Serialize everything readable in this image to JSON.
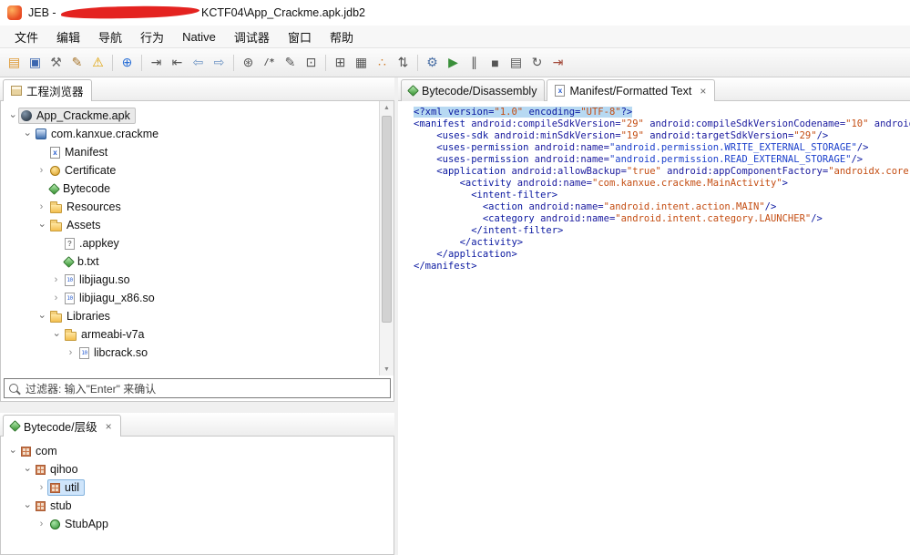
{
  "colors": {
    "tag": "#0a18a0",
    "attr": "#1a1a9e",
    "string": "#c44d12",
    "link": "#1c40cc",
    "selection": "#b7d9f2",
    "redaction": "#e42320"
  },
  "titlebar": {
    "prefix": "JEB - ",
    "suffix": "KCTF04\\App_Crackme.apk.jdb2"
  },
  "menubar": {
    "items": [
      "文件",
      "编辑",
      "导航",
      "行为",
      "Native",
      "调试器",
      "窗口",
      "帮助"
    ]
  },
  "toolbar": {
    "items": [
      {
        "name": "open-button",
        "glyph": "▤",
        "color": "#dd952d"
      },
      {
        "name": "save-button",
        "glyph": "▣",
        "color": "#3a66b0"
      },
      {
        "name": "tools-button",
        "glyph": "⚒",
        "color": "#6b6b6b"
      },
      {
        "name": "edit-button",
        "glyph": "✎",
        "color": "#a8772e"
      },
      {
        "name": "warning-button",
        "glyph": "⚠",
        "color": "#dfa000"
      },
      {
        "sep": true
      },
      {
        "name": "browser-button",
        "glyph": "⊕",
        "color": "#2a6fd6"
      },
      {
        "sep": true
      },
      {
        "name": "jump-in-button",
        "glyph": "⇥",
        "color": "#555555"
      },
      {
        "name": "jump-out-button",
        "glyph": "⇤",
        "color": "#555555"
      },
      {
        "name": "back-button",
        "glyph": "⇦",
        "color": "#6f95c4"
      },
      {
        "name": "forward-button",
        "glyph": "⇨",
        "color": "#6f95c4"
      },
      {
        "sep": true
      },
      {
        "name": "decompile-button",
        "glyph": "⊛",
        "color": "#555555"
      },
      {
        "name": "comment-button",
        "glyph": "/*",
        "color": "#555555",
        "small": true
      },
      {
        "name": "rename-button",
        "glyph": "✎",
        "color": "#555555"
      },
      {
        "name": "copy-button",
        "glyph": "⊡",
        "color": "#555555"
      },
      {
        "sep": true
      },
      {
        "name": "table-view-button",
        "glyph": "⊞",
        "color": "#555555"
      },
      {
        "name": "grid-view-button",
        "glyph": "▦",
        "color": "#555555"
      },
      {
        "name": "cross-refs-button",
        "glyph": "∴",
        "color": "#cf7c2a"
      },
      {
        "name": "sort-button",
        "glyph": "⇅",
        "color": "#555555"
      },
      {
        "sep": true
      },
      {
        "name": "debug-attach-button",
        "glyph": "⚙",
        "color": "#4a6fa5"
      },
      {
        "name": "debug-run-button",
        "glyph": "▶",
        "color": "#3a8f3a"
      },
      {
        "name": "debug-pause-button",
        "glyph": "∥",
        "color": "#555555"
      },
      {
        "name": "debug-stop-button",
        "glyph": "■",
        "color": "#555555"
      },
      {
        "name": "memory-button",
        "glyph": "▤",
        "color": "#555555"
      },
      {
        "name": "restart-button",
        "glyph": "↻",
        "color": "#555555"
      },
      {
        "name": "detach-button",
        "glyph": "⇥",
        "color": "#a34a3a"
      }
    ]
  },
  "project": {
    "tab_label": "工程浏览器",
    "filter_text": "过滤器: 输入\"Enter\" 来确认",
    "tree": [
      {
        "label": "App_Crackme.apk",
        "depth": 0,
        "icon": "apk",
        "chevron": "open",
        "selected": "inactive"
      },
      {
        "label": "com.kanxue.crackme",
        "depth": 1,
        "icon": "package",
        "chevron": "open"
      },
      {
        "label": "Manifest",
        "depth": 2,
        "icon": "manifest",
        "chevron": null
      },
      {
        "label": "Certificate",
        "depth": 2,
        "icon": "cert",
        "chevron": "closed"
      },
      {
        "label": "Bytecode",
        "depth": 2,
        "icon": "gem",
        "chevron": null
      },
      {
        "label": "Resources",
        "depth": 2,
        "icon": "folder",
        "chevron": "closed"
      },
      {
        "label": "Assets",
        "depth": 2,
        "icon": "folder",
        "chevron": "open"
      },
      {
        "label": ".appkey",
        "depth": 3,
        "icon": "unknown",
        "chevron": null
      },
      {
        "label": "b.txt",
        "depth": 3,
        "icon": "gem",
        "chevron": null
      },
      {
        "label": "libjiagu.so",
        "depth": 3,
        "icon": "binary",
        "chevron": "closed"
      },
      {
        "label": "libjiagu_x86.so",
        "depth": 3,
        "icon": "binary",
        "chevron": "closed"
      },
      {
        "label": "Libraries",
        "depth": 2,
        "icon": "folder",
        "chevron": "open"
      },
      {
        "label": "armeabi-v7a",
        "depth": 3,
        "icon": "folder",
        "chevron": "open"
      },
      {
        "label": "libcrack.so",
        "depth": 4,
        "icon": "binary",
        "chevron": "closed"
      }
    ]
  },
  "hierarchy": {
    "tab_label": "Bytecode/层级",
    "tree": [
      {
        "label": "com",
        "depth": 0,
        "icon": "pkg-grid",
        "chevron": "open"
      },
      {
        "label": "qihoo",
        "depth": 1,
        "icon": "pkg-grid",
        "chevron": "open"
      },
      {
        "label": "util",
        "depth": 2,
        "icon": "pkg-grid",
        "chevron": "closed",
        "selected": "active"
      },
      {
        "label": "stub",
        "depth": 1,
        "icon": "pkg-grid",
        "chevron": "open"
      },
      {
        "label": "StubApp",
        "depth": 2,
        "icon": "class",
        "chevron": "closed"
      }
    ]
  },
  "editor": {
    "close_glyph": "×",
    "tabs": [
      {
        "label": "Bytecode/Disassembly",
        "icon": "gem",
        "selected": false,
        "closable": false
      },
      {
        "label": "Manifest/Formatted Text",
        "icon": "manifest",
        "selected": true,
        "closable": true
      }
    ],
    "code": [
      {
        "selected": true,
        "segs": [
          [
            "<?xml version=",
            "tag"
          ],
          [
            "\"1.0\"",
            "string"
          ],
          [
            " encoding=",
            "tag"
          ],
          [
            "\"UTF-8\"",
            "string"
          ],
          [
            "?>",
            "tag"
          ]
        ]
      },
      {
        "segs": [
          [
            "<manifest",
            "tag"
          ],
          [
            " android:compileSdkVersion=",
            "attr"
          ],
          [
            "\"29\"",
            "string"
          ],
          [
            " android:compileSdkVersionCodename=",
            "attr"
          ],
          [
            "\"10\"",
            "string"
          ],
          [
            " android:ve",
            "attr"
          ]
        ]
      },
      {
        "segs": [
          [
            "    ",
            "plain"
          ],
          [
            "<uses-sdk",
            "tag"
          ],
          [
            " android:minSdkVersion=",
            "attr"
          ],
          [
            "\"19\"",
            "string"
          ],
          [
            " android:targetSdkVersion=",
            "attr"
          ],
          [
            "\"29\"",
            "string"
          ],
          [
            "/>",
            "tag"
          ]
        ]
      },
      {
        "segs": [
          [
            "    ",
            "plain"
          ],
          [
            "<uses-permission",
            "tag"
          ],
          [
            " android:name=",
            "attr"
          ],
          [
            "\"android.permission.WRITE_EXTERNAL_STORAGE\"",
            "link"
          ],
          [
            "/>",
            "tag"
          ]
        ]
      },
      {
        "segs": [
          [
            "    ",
            "plain"
          ],
          [
            "<uses-permission",
            "tag"
          ],
          [
            " android:name=",
            "attr"
          ],
          [
            "\"android.permission.READ_EXTERNAL_STORAGE\"",
            "link"
          ],
          [
            "/>",
            "tag"
          ]
        ]
      },
      {
        "segs": [
          [
            "    ",
            "plain"
          ],
          [
            "<application",
            "tag"
          ],
          [
            " android:allowBackup=",
            "attr"
          ],
          [
            "\"true\"",
            "string"
          ],
          [
            " android:appComponentFactory=",
            "attr"
          ],
          [
            "\"androidx.core.app.C",
            "string"
          ]
        ]
      },
      {
        "segs": [
          [
            "        ",
            "plain"
          ],
          [
            "<activity",
            "tag"
          ],
          [
            " android:name=",
            "attr"
          ],
          [
            "\"com.kanxue.crackme.MainActivity\"",
            "string"
          ],
          [
            ">",
            "tag"
          ]
        ]
      },
      {
        "segs": [
          [
            "          ",
            "plain"
          ],
          [
            "<intent-filter>",
            "tag"
          ]
        ]
      },
      {
        "segs": [
          [
            "            ",
            "plain"
          ],
          [
            "<action",
            "tag"
          ],
          [
            " android:name=",
            "attr"
          ],
          [
            "\"android.intent.action.MAIN\"",
            "string"
          ],
          [
            "/>",
            "tag"
          ]
        ]
      },
      {
        "segs": [
          [
            "            ",
            "plain"
          ],
          [
            "<category",
            "tag"
          ],
          [
            " android:name=",
            "attr"
          ],
          [
            "\"android.intent.category.LAUNCHER\"",
            "string"
          ],
          [
            "/>",
            "tag"
          ]
        ]
      },
      {
        "segs": [
          [
            "          ",
            "plain"
          ],
          [
            "</intent-filter>",
            "tag"
          ]
        ]
      },
      {
        "segs": [
          [
            "        ",
            "plain"
          ],
          [
            "</activity>",
            "tag"
          ]
        ]
      },
      {
        "segs": [
          [
            "    ",
            "plain"
          ],
          [
            "</application>",
            "tag"
          ]
        ]
      },
      {
        "segs": [
          [
            "</manifest>",
            "tag"
          ]
        ]
      }
    ]
  }
}
